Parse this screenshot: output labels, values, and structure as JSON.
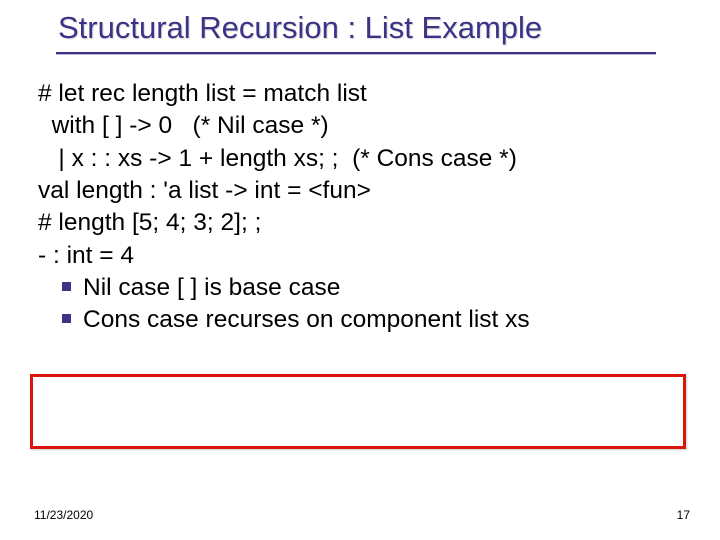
{
  "title": "Structural Recursion : List Example",
  "code": {
    "l1": "# let rec length list = match list",
    "l2": "  with [ ] -> 0   (* Nil case *)",
    "l3": "   | x : : xs -> 1 + length xs; ;  (* Cons case *)",
    "l4": "val length : 'a list -> int = <fun>",
    "l5": "# length [5; 4; 3; 2]; ;",
    "l6": "- : int = 4"
  },
  "bullets": {
    "b1": "Nil case [ ]  is base case",
    "b2": "Cons case recurses on component list xs"
  },
  "footer": {
    "date": "11/23/2020",
    "page": "17"
  }
}
